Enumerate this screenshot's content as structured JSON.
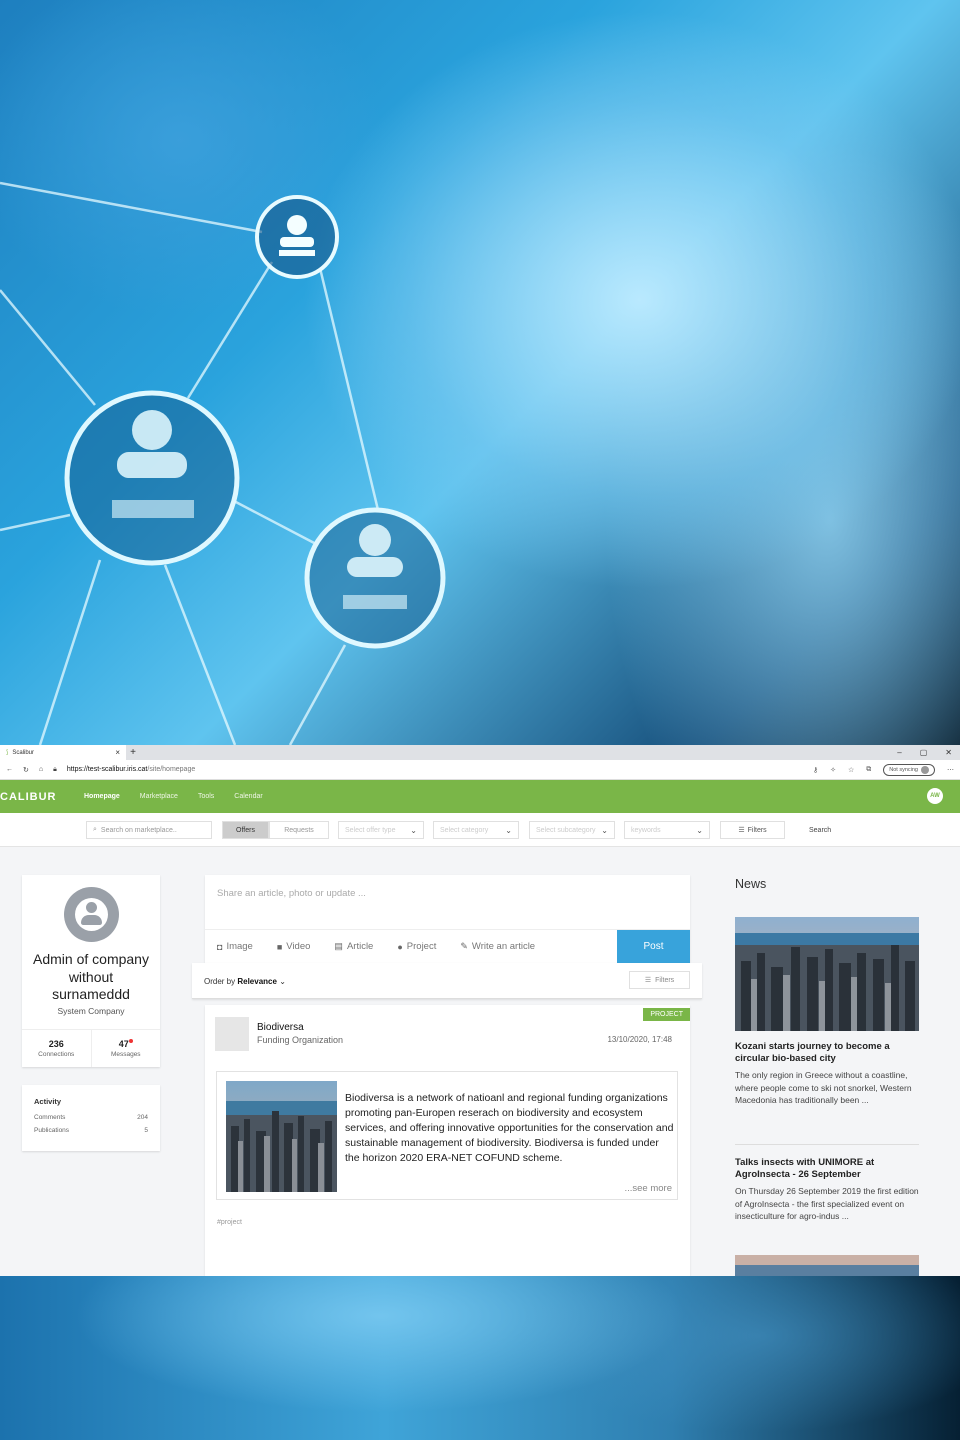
{
  "browser": {
    "tab_title": "Scalibur",
    "tab_close": "×",
    "new_tab": "+",
    "url_host": "https://test-scalibur.iris.cat",
    "url_path": "/site/homepage",
    "sync_label": "Not syncing",
    "window_controls": [
      "–",
      "▢",
      "✕"
    ]
  },
  "app": {
    "logo": "CALIBUR",
    "nav": [
      "Homepage",
      "Marketplace",
      "Tools",
      "Calendar"
    ],
    "avatar_initials": "AW"
  },
  "filterbar": {
    "search_placeholder": "Search on marketplace..",
    "offers": "Offers",
    "requests": "Requests",
    "offer_type": "Select offer type",
    "category": "Select category",
    "subcategory": "Select subcategory",
    "keywords": "keywords",
    "filters": "Filters",
    "search": "Search"
  },
  "profile": {
    "name": "Admin of company without surnameddd",
    "company": "System Company",
    "connections": "236",
    "connections_label": "Connections",
    "messages": "47",
    "messages_label": "Messages"
  },
  "activity": {
    "title": "Activity",
    "rows": [
      {
        "label": "Comments",
        "value": "204"
      },
      {
        "label": "Publications",
        "value": "5"
      }
    ]
  },
  "composer": {
    "placeholder": "Share an article, photo or update ...",
    "actions": [
      "Image",
      "Video",
      "Article",
      "Project",
      "Write an article"
    ],
    "post": "Post"
  },
  "order": {
    "prefix": "Order by",
    "value": "Relevance",
    "filters": "Filters"
  },
  "feed_post": {
    "badge": "PROJECT",
    "org_name": "Biodiversa",
    "org_type": "Funding Organization",
    "date": "13/10/2020, 17:48",
    "text": "Biodiversa is a network of natioanl and regional funding organizations promoting pan-Europen reserach on biodiversity and ecosystem services, and offering innovative opportunities for the conservation and sustainable management of biodiversity. Biodiversa is funded under the horizon 2020 ERA-NET COFUND scheme.",
    "see_more": "...see more",
    "hashtag": "#project"
  },
  "news": {
    "title": "News",
    "items": [
      {
        "headline": "Kozani starts journey to become a circular bio-based city",
        "excerpt": "The only region in Greece without a coastline, where people come to ski not snorkel, Western Macedonia has traditionally been ..."
      },
      {
        "headline": "Talks insects with UNIMORE at AgroInsecta - 26 September",
        "excerpt": "On Thursday 26 September 2019 the first edition of AgroInsecta - the first specialized event on insecticulture for agro-indus ..."
      }
    ]
  },
  "colors": {
    "brand_green": "#7ab648",
    "post_blue": "#38a3db",
    "badge_green": "#7ab648"
  }
}
